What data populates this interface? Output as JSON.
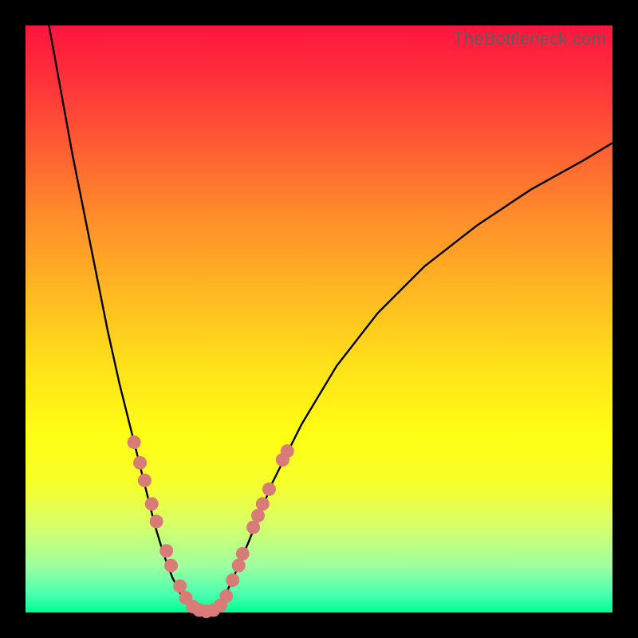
{
  "watermark": "TheBottleneck.com",
  "colors": {
    "background": "#000000",
    "gradient_top": "#ff153f",
    "gradient_bottom": "#00ff90",
    "curve": "#000000",
    "markers": "#d97b77"
  },
  "chart_data": {
    "type": "line",
    "title": "",
    "xlabel": "",
    "ylabel": "",
    "xlim": [
      0,
      100
    ],
    "ylim": [
      0,
      100
    ],
    "grid": false,
    "legend": false,
    "series": [
      {
        "name": "left-branch",
        "x": [
          4,
          6,
          8,
          10,
          12,
          14,
          16,
          18,
          20,
          22,
          23.5,
          25,
          26.5,
          28
        ],
        "y": [
          100,
          89,
          78,
          68,
          58,
          48,
          39,
          31,
          23,
          15,
          10,
          6,
          3,
          1
        ]
      },
      {
        "name": "valley",
        "x": [
          28,
          29,
          30,
          31,
          32,
          33
        ],
        "y": [
          1,
          0.3,
          0,
          0,
          0.3,
          1
        ]
      },
      {
        "name": "right-branch",
        "x": [
          33,
          35,
          38,
          42,
          47,
          53,
          60,
          68,
          77,
          86,
          95,
          100
        ],
        "y": [
          1,
          5,
          12,
          22,
          32,
          42,
          51,
          59,
          66,
          72,
          77,
          80
        ]
      }
    ],
    "markers": {
      "name": "highlighted-points",
      "shape": "circle",
      "color": "#d97b77",
      "points": [
        {
          "x": 18.5,
          "y": 29
        },
        {
          "x": 19.5,
          "y": 25.5
        },
        {
          "x": 20.3,
          "y": 22.5
        },
        {
          "x": 21.5,
          "y": 18.5
        },
        {
          "x": 22.3,
          "y": 15.5
        },
        {
          "x": 24.0,
          "y": 10.5
        },
        {
          "x": 24.8,
          "y": 8.0
        },
        {
          "x": 26.3,
          "y": 4.5
        },
        {
          "x": 27.3,
          "y": 2.5
        },
        {
          "x": 28.5,
          "y": 1.0
        },
        {
          "x": 29.6,
          "y": 0.4
        },
        {
          "x": 30.8,
          "y": 0.2
        },
        {
          "x": 32.0,
          "y": 0.4
        },
        {
          "x": 33.2,
          "y": 1.2
        },
        {
          "x": 34.2,
          "y": 2.8
        },
        {
          "x": 35.3,
          "y": 5.5
        },
        {
          "x": 36.3,
          "y": 8.0
        },
        {
          "x": 37.0,
          "y": 10.0
        },
        {
          "x": 38.8,
          "y": 14.5
        },
        {
          "x": 39.6,
          "y": 16.5
        },
        {
          "x": 40.4,
          "y": 18.5
        },
        {
          "x": 41.5,
          "y": 21.0
        },
        {
          "x": 43.8,
          "y": 26.0
        },
        {
          "x": 44.6,
          "y": 27.5
        }
      ]
    }
  }
}
